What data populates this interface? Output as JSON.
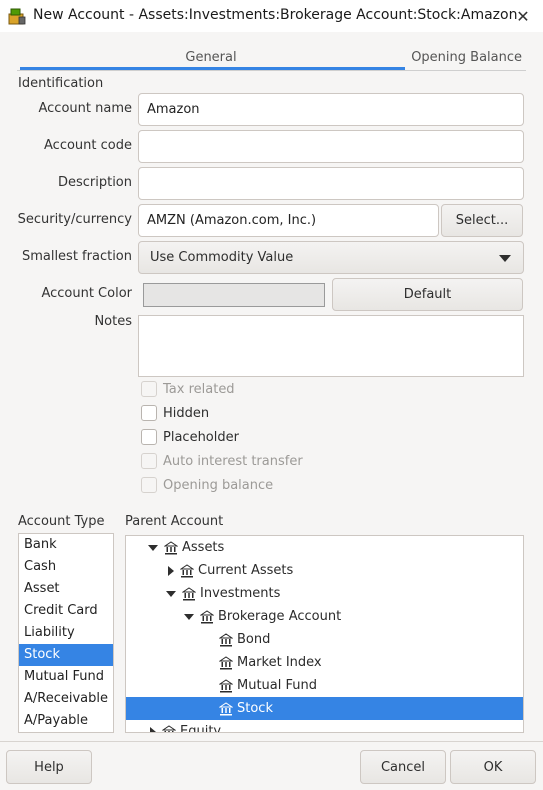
{
  "window": {
    "title": "New Account - Assets:Investments:Brokerage Account:Stock:Amazon",
    "close_glyph": "✕"
  },
  "tabs": [
    {
      "label": "General",
      "active": true
    },
    {
      "label": "Opening Balance",
      "active": false
    }
  ],
  "form": {
    "identification_label": "Identification",
    "account_name_label": "Account name",
    "account_name_value": "Amazon",
    "account_code_label": "Account code",
    "account_code_value": "",
    "description_label": "Description",
    "description_value": "",
    "security_label": "Security/currency",
    "security_value": "AMZN (Amazon.com, Inc.)",
    "select_button": "Select...",
    "fraction_label": "Smallest fraction",
    "fraction_value": "Use Commodity Value",
    "color_label": "Account Color",
    "color_default_button": "Default",
    "notes_label": "Notes",
    "notes_value": ""
  },
  "checkboxes": [
    {
      "label": "Tax related",
      "checked": false,
      "disabled": true
    },
    {
      "label": "Hidden",
      "checked": false,
      "disabled": false
    },
    {
      "label": "Placeholder",
      "checked": false,
      "disabled": false
    },
    {
      "label": "Auto interest transfer",
      "checked": false,
      "disabled": true
    },
    {
      "label": "Opening balance",
      "checked": false,
      "disabled": true
    }
  ],
  "account_type": {
    "label": "Account Type",
    "items": [
      "Bank",
      "Cash",
      "Asset",
      "Credit Card",
      "Liability",
      "Stock",
      "Mutual Fund",
      "A/Receivable",
      "A/Payable"
    ],
    "selected": "Stock"
  },
  "parent_account": {
    "label": "Parent Account",
    "rows": [
      {
        "label": "Assets",
        "level": 0,
        "expander": "open",
        "selected": false
      },
      {
        "label": "Current Assets",
        "level": 1,
        "expander": "closed",
        "selected": false
      },
      {
        "label": "Investments",
        "level": 1,
        "expander": "open",
        "selected": false
      },
      {
        "label": "Brokerage Account",
        "level": 2,
        "expander": "open",
        "selected": false
      },
      {
        "label": "Bond",
        "level": 3,
        "expander": "none",
        "selected": false
      },
      {
        "label": "Market Index",
        "level": 3,
        "expander": "none",
        "selected": false
      },
      {
        "label": "Mutual Fund",
        "level": 3,
        "expander": "none",
        "selected": false
      },
      {
        "label": "Stock",
        "level": 3,
        "expander": "none",
        "selected": true
      },
      {
        "label": "Equity",
        "level": 0,
        "expander": "closed",
        "selected": false
      }
    ]
  },
  "footer": {
    "help_button": "Help",
    "cancel_button": "Cancel",
    "ok_button": "OK"
  },
  "colors": {
    "accent": "#3584e4",
    "window_bg": "#f6f5f4"
  }
}
